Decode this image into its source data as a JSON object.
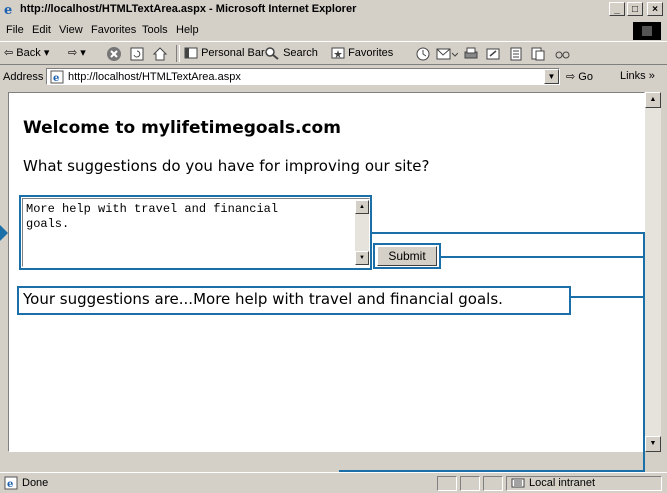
{
  "window": {
    "title": "http://localhost/HTMLTextArea.aspx - Microsoft Internet Explorer",
    "min_label": "_",
    "max_label": "□",
    "close_label": "×"
  },
  "menu": [
    "File",
    "Edit",
    "View",
    "Favorites",
    "Tools",
    "Help"
  ],
  "toolbar": {
    "back": "Back",
    "personal_bar": "Personal Bar",
    "search": "Search",
    "favorites": "Favorites"
  },
  "address": {
    "label": "Address",
    "url": "http://localhost/HTMLTextArea.aspx",
    "go": "Go",
    "links": "Links »"
  },
  "page": {
    "heading": "Welcome to mylifetimegoals.com",
    "question": "What suggestions do you have for improving our site?",
    "textarea_value": "More help with travel and financial\ngoals.",
    "submit_label": "Submit",
    "result": "Your suggestions are...More help with travel and financial goals."
  },
  "status": {
    "text": "Done",
    "zone": "Local intranet"
  },
  "colors": {
    "callout": "#1a6fa8"
  }
}
